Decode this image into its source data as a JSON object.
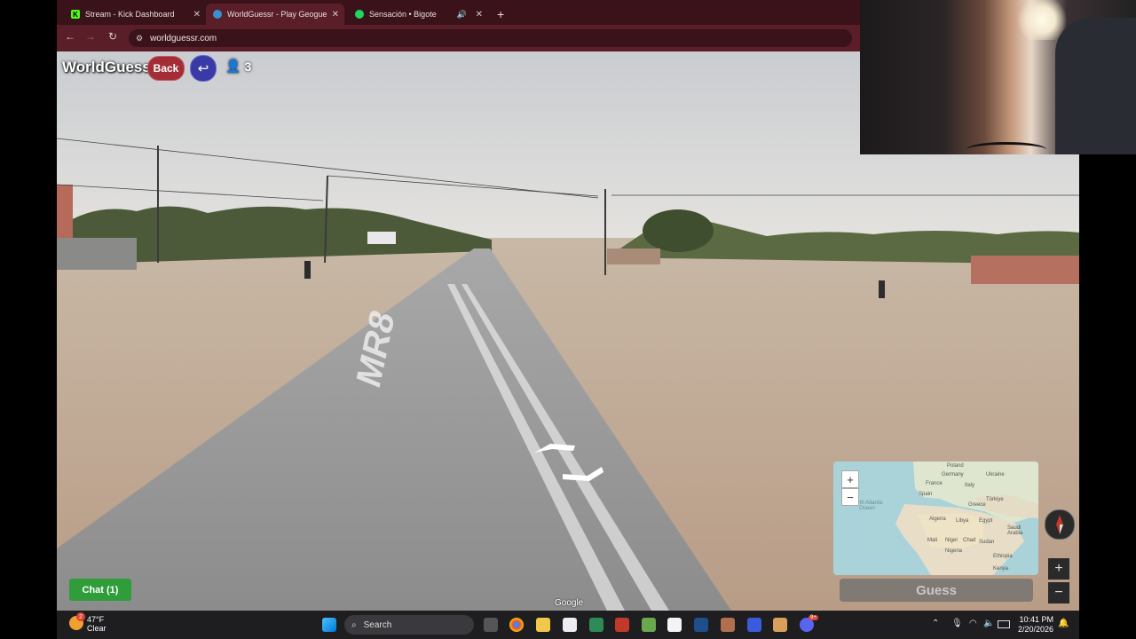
{
  "browser": {
    "tabs": [
      {
        "label": "Stream - Kick Dashboard",
        "favicon_color": "#53fc18",
        "favicon_glyph": "K"
      },
      {
        "label": "WorldGuessr - Play Geoguessr",
        "favicon_color": "#3a8fd0",
        "favicon_glyph": ""
      },
      {
        "label": "Sensación • Bigote",
        "favicon_color": "#1ed760",
        "favicon_glyph": ""
      }
    ],
    "new_tab_glyph": "+",
    "url": "worldguessr.com"
  },
  "game": {
    "logo": "WorldGuessr",
    "back_label": "Back",
    "return_icon": "return-arrow-icon",
    "player_count": "3",
    "chat_label": "Chat (1)",
    "guess_label": "Guess",
    "attribution": "Google",
    "road_marking": "MR8",
    "map_labels": [
      "Poland",
      "Germany",
      "Ukraine",
      "France",
      "Italy",
      "Spain",
      "Türkiye",
      "Greece",
      "North Atlantic Ocean",
      "Algeria",
      "Libya",
      "Egypt",
      "Saudi Arabia",
      "Mali",
      "Niger",
      "Chad",
      "Sudan",
      "Nigeria",
      "Ethiopia",
      "Kenya"
    ],
    "zoom_in": "+",
    "zoom_out": "−"
  },
  "taskbar": {
    "weather_temp": "47°F",
    "weather_desc": "Clear",
    "weather_badge": "2",
    "search_placeholder": "Search",
    "time": "10:41 PM",
    "date": "2/20/2026",
    "notification_count": "9+"
  },
  "colors": {
    "tabbar": "#3a1219",
    "address_bar": "#5a1e28",
    "back_button": "#a32d36",
    "return_button": "#3a3aa6",
    "chat_button": "#2e9d3a"
  }
}
